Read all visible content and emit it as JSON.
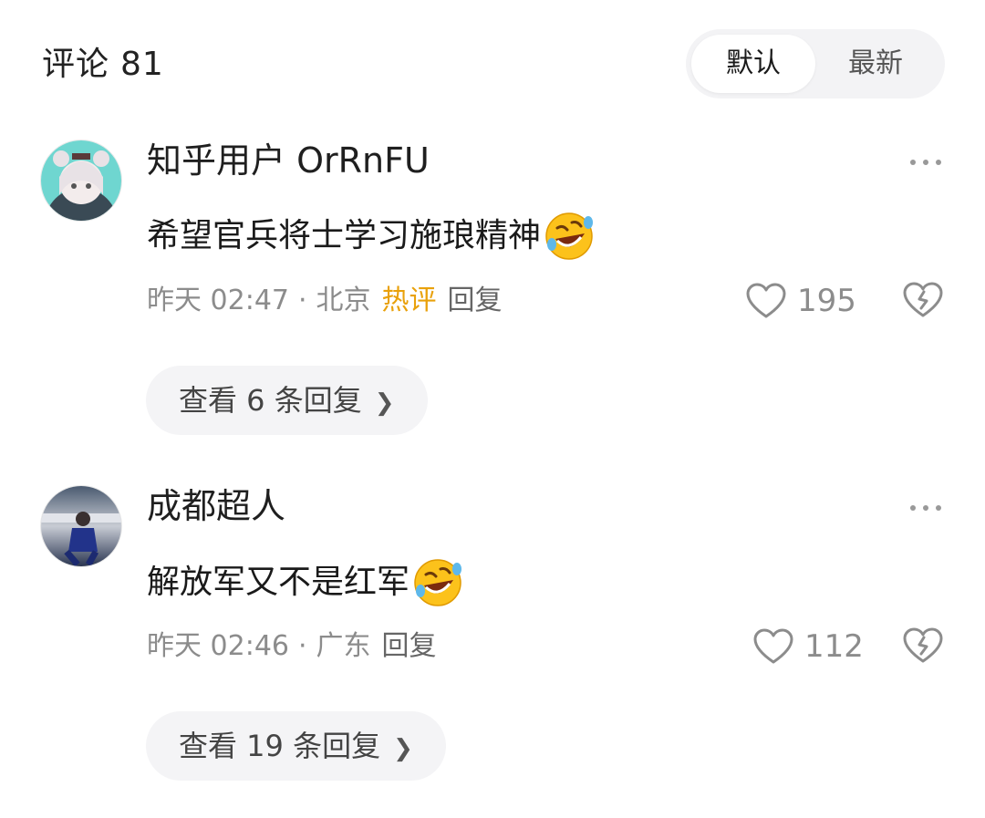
{
  "header": {
    "title": "评论",
    "count": "81"
  },
  "sort": {
    "default_label": "默认",
    "latest_label": "最新",
    "selected": "默认"
  },
  "comments": [
    {
      "author": "知乎用户 OrRnFU",
      "text": "希望官兵将士学习施琅精神",
      "emoji": "rolling-on-floor-laughing-emoji",
      "time": "昨天 02:47",
      "separator": "·",
      "location": "北京",
      "badge": "热评",
      "reply_label": "回复",
      "likes": "195",
      "view_replies": "查看 6 条回复"
    },
    {
      "author": "成都超人",
      "text": "解放军又不是红军",
      "emoji": "rolling-on-floor-laughing-emoji",
      "time": "昨天 02:46",
      "separator": "·",
      "location": "广东",
      "reply_label": "回复",
      "likes": "112",
      "view_replies": "查看 19 条回复"
    }
  ],
  "icons": {
    "like": "heart-outline-icon",
    "dislike": "broken-heart-icon",
    "more": "more-dots-icon",
    "chevron": "chevron-right-icon"
  },
  "colors": {
    "hot_badge": "#e9a10b",
    "meta_text": "#8c8c8c",
    "pill_bg": "#f4f4f6"
  }
}
